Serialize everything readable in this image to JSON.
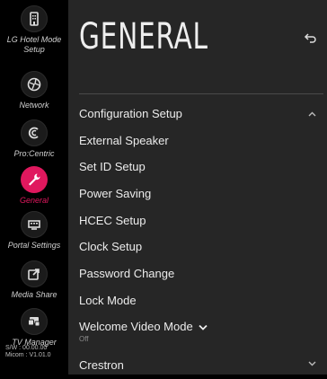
{
  "sidebar": {
    "items": [
      {
        "label": "LG Hotel Mode Setup",
        "icon": "hotel-icon"
      },
      {
        "label": "Network",
        "icon": "network-globe-icon"
      },
      {
        "label": "Pro:Centric",
        "icon": "procentric-icon"
      },
      {
        "label": "General",
        "icon": "wrench-icon",
        "active": true
      },
      {
        "label": "Portal Settings",
        "icon": "portal-icon"
      },
      {
        "label": "Media Share",
        "icon": "media-share-icon"
      },
      {
        "label": "TV Manager",
        "icon": "tv-manager-icon"
      }
    ],
    "sw_version": "S/W : 00.00.00",
    "micom_version": "Micom : V1.01.0"
  },
  "header": {
    "title": "GENERAL"
  },
  "menu": {
    "items": [
      {
        "label": "Configuration Setup"
      },
      {
        "label": "External Speaker"
      },
      {
        "label": "Set ID Setup"
      },
      {
        "label": "Power Saving"
      },
      {
        "label": "HCEC Setup"
      },
      {
        "label": "Clock Setup"
      },
      {
        "label": "Password Change"
      },
      {
        "label": "Lock Mode"
      },
      {
        "label": "Welcome Video Mode",
        "value": "Off"
      },
      {
        "label": "Crestron"
      }
    ]
  },
  "colors": {
    "accent": "#e0185e",
    "panel": "#262626",
    "background": "#000000"
  }
}
